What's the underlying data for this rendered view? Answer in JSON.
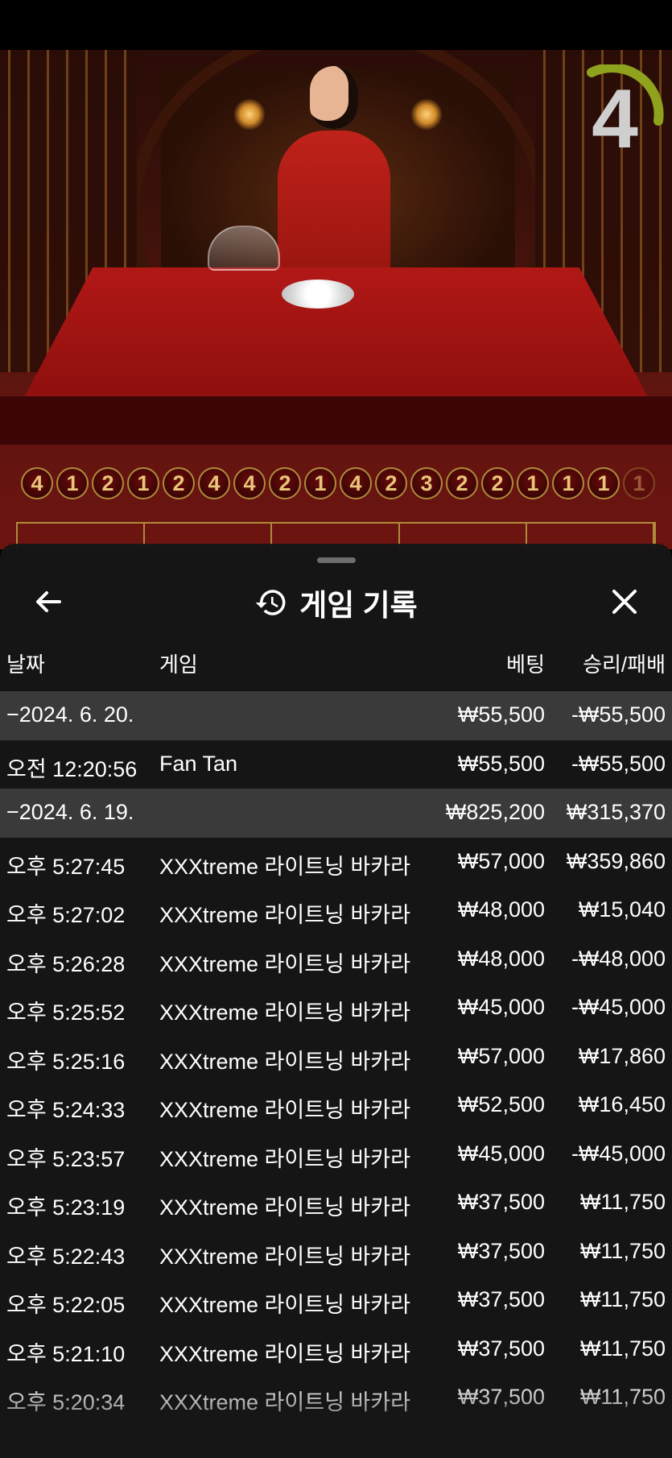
{
  "timer": {
    "value": "4"
  },
  "roadmap": [
    "4",
    "1",
    "2",
    "1",
    "2",
    "4",
    "4",
    "2",
    "1",
    "4",
    "2",
    "3",
    "2",
    "2",
    "1",
    "1",
    "1",
    "1"
  ],
  "sheet": {
    "title": "게임 기록",
    "icons": {
      "back": "back-arrow-icon",
      "history": "history-clock-icon",
      "close": "close-icon"
    },
    "columns": {
      "date": "날짜",
      "game": "게임",
      "bet": "베팅",
      "win": "승리/패배"
    },
    "rows": [
      {
        "type": "day",
        "date": "−2024. 6. 20.",
        "game": "",
        "bet": "₩55,500",
        "win": "-₩55,500"
      },
      {
        "type": "game",
        "date": "오전 12:20:56",
        "game": "Fan Tan",
        "bet": "₩55,500",
        "win": "-₩55,500"
      },
      {
        "type": "day",
        "date": "−2024. 6. 19.",
        "game": "",
        "bet": "₩825,200",
        "win": "₩315,370"
      },
      {
        "type": "game",
        "date": "오후 5:27:45",
        "game": "XXXtreme 라이트닝 바카라",
        "bet": "₩57,000",
        "win": "₩359,860"
      },
      {
        "type": "game",
        "date": "오후 5:27:02",
        "game": "XXXtreme 라이트닝 바카라",
        "bet": "₩48,000",
        "win": "₩15,040"
      },
      {
        "type": "game",
        "date": "오후 5:26:28",
        "game": "XXXtreme 라이트닝 바카라",
        "bet": "₩48,000",
        "win": "-₩48,000"
      },
      {
        "type": "game",
        "date": "오후 5:25:52",
        "game": "XXXtreme 라이트닝 바카라",
        "bet": "₩45,000",
        "win": "-₩45,000"
      },
      {
        "type": "game",
        "date": "오후 5:25:16",
        "game": "XXXtreme 라이트닝 바카라",
        "bet": "₩57,000",
        "win": "₩17,860"
      },
      {
        "type": "game",
        "date": "오후 5:24:33",
        "game": "XXXtreme 라이트닝 바카라",
        "bet": "₩52,500",
        "win": "₩16,450"
      },
      {
        "type": "game",
        "date": "오후 5:23:57",
        "game": "XXXtreme 라이트닝 바카라",
        "bet": "₩45,000",
        "win": "-₩45,000"
      },
      {
        "type": "game",
        "date": "오후 5:23:19",
        "game": "XXXtreme 라이트닝 바카라",
        "bet": "₩37,500",
        "win": "₩11,750"
      },
      {
        "type": "game",
        "date": "오후 5:22:43",
        "game": "XXXtreme 라이트닝 바카라",
        "bet": "₩37,500",
        "win": "₩11,750"
      },
      {
        "type": "game",
        "date": "오후 5:22:05",
        "game": "XXXtreme 라이트닝 바카라",
        "bet": "₩37,500",
        "win": "₩11,750"
      },
      {
        "type": "game",
        "date": "오후 5:21:10",
        "game": "XXXtreme 라이트닝 바카라",
        "bet": "₩37,500",
        "win": "₩11,750"
      },
      {
        "type": "game",
        "date": "오후 5:20:34",
        "game": "XXXtreme 라이트닝 바카라",
        "bet": "₩37,500",
        "win": "₩11,750"
      }
    ]
  },
  "colors": {
    "sheet_bg": "#161616",
    "day_row_bg": "#3a3a3a",
    "gold": "#b08a3c",
    "table_red": "#b11816"
  }
}
